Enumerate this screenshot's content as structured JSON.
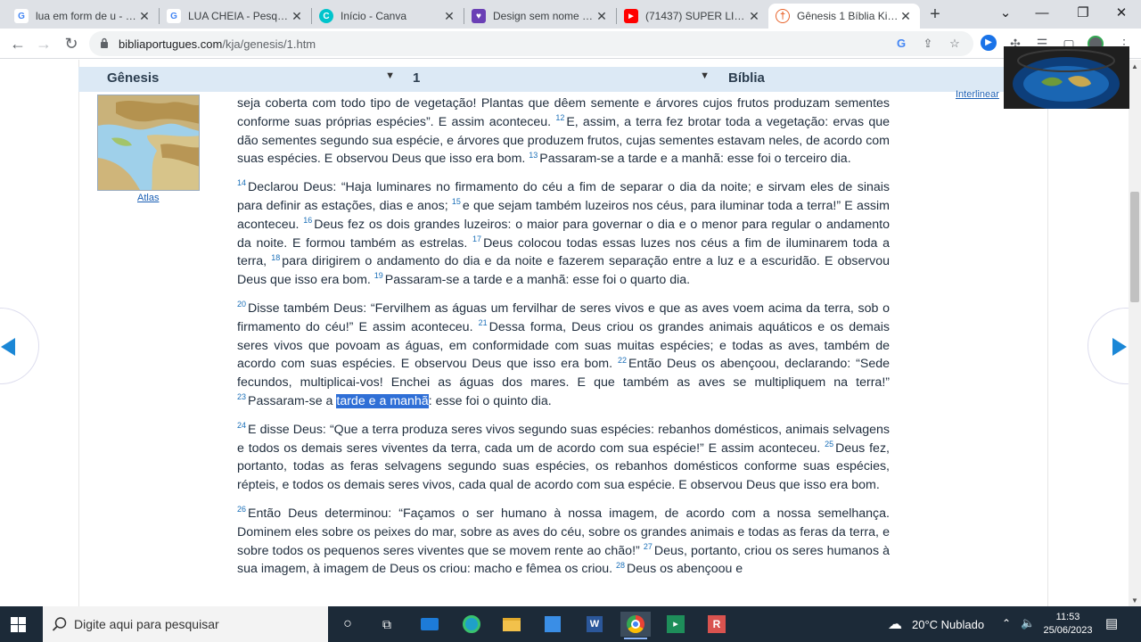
{
  "tabs": [
    {
      "title": "lua em form de u - Pe",
      "icon": "google-icon",
      "color": "#4285f4",
      "glyph": "G"
    },
    {
      "title": "LUA CHEIA - Pesquisa",
      "icon": "google-icon",
      "color": "#4285f4",
      "glyph": "G"
    },
    {
      "title": "Início - Canva",
      "icon": "canva-icon",
      "color": "#00c4cc",
      "glyph": "C"
    },
    {
      "title": "Design sem nome - M",
      "icon": "shield-icon",
      "color": "#6a3fb5",
      "glyph": "♥"
    },
    {
      "title": "(71437) SUPER LIVE E",
      "icon": "youtube-icon",
      "color": "#ff0000",
      "glyph": "▶"
    },
    {
      "title": "Gênesis 1 Bíblia King",
      "icon": "cross-icon",
      "color": "#e8632b",
      "glyph": "†"
    }
  ],
  "new_tab": "+",
  "window_controls": {
    "chevron": "⌄",
    "minimize": "—",
    "restore": "❐",
    "close": "✕"
  },
  "address": {
    "host": "bibliaportugues.com",
    "path": "/kja/genesis/1.htm"
  },
  "page": {
    "book_select": "Gênesis",
    "chapter_select": "1",
    "bible_label": "Bíblia",
    "interlinear": "Interlinear",
    "atlas_label": "Atlas",
    "paragraphs": [
      {
        "segments": [
          {
            "t": "seja coberta com todo tipo de vegetação! Plantas que dêem semente e árvores cujos frutos produzam sementes conforme suas próprias espécies”. E assim aconteceu. "
          },
          {
            "v": "12"
          },
          {
            "t": "E, assim, a terra fez brotar toda a vegetação: ervas que dão sementes segundo sua espécie, e árvores que produzem frutos, cujas sementes estavam neles, de acordo com suas espécies. E observou Deus que isso era bom. "
          },
          {
            "v": "13"
          },
          {
            "t": "Passaram-se a tarde e a manhã: esse foi o terceiro dia."
          }
        ]
      },
      {
        "segments": [
          {
            "v": "14"
          },
          {
            "t": "Declarou Deus: “Haja luminares no firmamento do céu a fim de separar o dia da noite; e sirvam eles de sinais para definir as estações, dias e anos; "
          },
          {
            "v": "15"
          },
          {
            "t": "e que sejam também luzeiros nos céus, para iluminar toda a terra!” E assim aconteceu. "
          },
          {
            "v": "16"
          },
          {
            "t": "Deus fez os dois grandes luzeiros: o maior para governar o dia e o menor para regular o andamento da noite. E formou também as estrelas. "
          },
          {
            "v": "17"
          },
          {
            "t": "Deus colocou todas essas luzes nos céus a fim de iluminarem toda a terra, "
          },
          {
            "v": "18"
          },
          {
            "t": "para dirigirem o andamento do dia e da noite e fazerem separação entre a luz e a escuridão. E observou Deus que isso era bom. "
          },
          {
            "v": "19"
          },
          {
            "t": "Passaram-se a tarde e a manhã: esse foi o quarto dia."
          }
        ]
      },
      {
        "segments": [
          {
            "v": "20"
          },
          {
            "t": "Disse também Deus: “Fervilhem as águas um fervilhar de seres vivos e que as aves voem acima da terra, sob o firmamento do céu!” E assim aconteceu. "
          },
          {
            "v": "21"
          },
          {
            "t": "Dessa forma, Deus criou os grandes animais aquáticos e os demais seres vivos que povoam as águas, em conformidade com suas muitas espécies; e todas as aves, também de acordo com suas espécies. E observou Deus que isso era bom. "
          },
          {
            "v": "22"
          },
          {
            "t": "Então Deus os abençoou, declarando: “Sede fecundos, multiplicai-vos! Enchei as águas dos mares. E que também as aves se multipliquem na terra!” "
          },
          {
            "v": "23"
          },
          {
            "t": "Passaram-se a "
          },
          {
            "h": "tarde e a manhã"
          },
          {
            "t": ": esse foi o quinto dia."
          }
        ]
      },
      {
        "segments": [
          {
            "v": "24"
          },
          {
            "t": "E disse Deus: “Que a terra produza seres vivos segundo suas espécies: rebanhos domésticos, animais selvagens e todos os demais seres viventes da terra, cada um de acordo com sua espécie!” E assim aconteceu. "
          },
          {
            "v": "25"
          },
          {
            "t": "Deus fez, portanto, todas as feras selvagens segundo suas espécies, os rebanhos domésticos conforme suas espécies, répteis, e todos os demais seres vivos, cada qual de acordo com sua espécie. E observou Deus que isso era bom."
          }
        ]
      },
      {
        "segments": [
          {
            "v": "26"
          },
          {
            "t": "Então Deus determinou: “Façamos o ser humano à nossa imagem, de acordo com a nossa semelhança. Dominem eles sobre os peixes do mar, sobre as aves do céu, sobre os grandes animais e todas as feras da terra, e sobre todos os pequenos seres viventes que se movem rente ao chão!” "
          },
          {
            "v": "27"
          },
          {
            "t": "Deus, portanto, criou os seres humanos à sua imagem, à imagem de Deus os criou: macho e fêmea os criou. "
          },
          {
            "v": "28"
          },
          {
            "t": "Deus os abençoou e"
          }
        ]
      }
    ]
  },
  "taskbar": {
    "search_placeholder": "Digite aqui para pesquisar",
    "weather": "20°C Nublado",
    "time": "11:53",
    "date": "25/06/2023"
  },
  "colors": {
    "accent": "#1b87d6",
    "selection": "#2f6fd6",
    "taskbar": "#1c2a38"
  }
}
